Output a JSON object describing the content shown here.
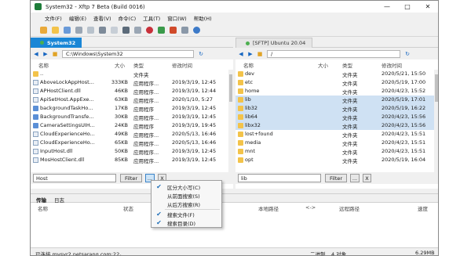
{
  "title": "System32 - Xftp 7 Beta (Build 0016)",
  "menu": [
    "文件(F)",
    "编辑(E)",
    "查看(V)",
    "命令(C)",
    "工具(T)",
    "窗口(W)",
    "帮助(H)"
  ],
  "left_pane": {
    "tab": "System32",
    "path": "C:\\Windows\\System32",
    "columns": [
      "名称",
      "大小",
      "类型",
      "修改时间"
    ],
    "rows": [
      {
        "name": "..",
        "size": "",
        "type": "文件夹",
        "modified": "",
        "icon": "folder"
      },
      {
        "name": "AboveLockAppHost...",
        "size": "333KB",
        "type": "应用程序...",
        "modified": "2019/3/19, 12:45",
        "icon": "file"
      },
      {
        "name": "APHostClient.dll",
        "size": "46KB",
        "type": "应用程序...",
        "modified": "2019/3/19, 12:44",
        "icon": "file"
      },
      {
        "name": "ApiSetHost.AppExe...",
        "size": "63KB",
        "type": "应用程序...",
        "modified": "2020/1/10, 5:27",
        "icon": "file"
      },
      {
        "name": "backgroundTaskHo...",
        "size": "17KB",
        "type": "应用程序",
        "modified": "2019/3/19, 12:45",
        "icon": "exe"
      },
      {
        "name": "BackgroundTransfe...",
        "size": "30KB",
        "type": "应用程序...",
        "modified": "2019/3/19, 12:45",
        "icon": "exe"
      },
      {
        "name": "CameraSettingsUIH...",
        "size": "24KB",
        "type": "应用程序",
        "modified": "2019/3/19, 19:45",
        "icon": "exe"
      },
      {
        "name": "CloudExperienceHo...",
        "size": "49KB",
        "type": "应用程序...",
        "modified": "2020/5/13, 16:46",
        "icon": "file"
      },
      {
        "name": "CloudExperienceHo...",
        "size": "65KB",
        "type": "应用程序...",
        "modified": "2020/5/13, 16:46",
        "icon": "file"
      },
      {
        "name": "InputHost.dll",
        "size": "50KB",
        "type": "应用程序...",
        "modified": "2019/3/19, 12:45",
        "icon": "file"
      },
      {
        "name": "MosHostClient.dll",
        "size": "85KB",
        "type": "应用程序...",
        "modified": "2019/3/19, 12:45",
        "icon": "file"
      }
    ],
    "filter_value": "Host",
    "filter_label": "Filter",
    "options_label": "...",
    "clear_label": "X"
  },
  "right_pane": {
    "tab": "[SFTP] Ubuntu 20.04",
    "path": "/",
    "columns": [
      "名称",
      "大小",
      "类型",
      "修改时间"
    ],
    "rows": [
      {
        "name": "dev",
        "type": "文件夹",
        "modified": "2020/5/21, 15:50",
        "selected": false
      },
      {
        "name": "etc",
        "type": "文件夹",
        "modified": "2020/5/19, 17:00",
        "selected": false
      },
      {
        "name": "home",
        "type": "文件夹",
        "modified": "2020/4/23, 15:52",
        "selected": false
      },
      {
        "name": "lib",
        "type": "文件夹",
        "modified": "2020/5/19, 17:01",
        "selected": true
      },
      {
        "name": "lib32",
        "type": "文件夹",
        "modified": "2020/5/19, 16:22",
        "selected": true
      },
      {
        "name": "lib64",
        "type": "文件夹",
        "modified": "2020/4/23, 15:56",
        "selected": true
      },
      {
        "name": "libx32",
        "type": "文件夹",
        "modified": "2020/4/23, 15:56",
        "selected": true
      },
      {
        "name": "lost+found",
        "type": "文件夹",
        "modified": "2020/4/23, 15:51",
        "selected": false
      },
      {
        "name": "media",
        "type": "文件夹",
        "modified": "2020/4/23, 15:51",
        "selected": false
      },
      {
        "name": "mnt",
        "type": "文件夹",
        "modified": "2020/4/23, 15:51",
        "selected": false
      },
      {
        "name": "opt",
        "type": "文件夹",
        "modified": "2020/5/19, 16:04",
        "selected": false
      }
    ],
    "filter_value": "lib",
    "filter_label": "Filter",
    "options_label": "...",
    "clear_label": "X"
  },
  "dropdown": {
    "items": [
      {
        "label": "区分大小写(C)",
        "checked": true
      },
      {
        "label": "从前面搜索(S)",
        "checked": false
      },
      {
        "label": "从后方搜索(R)",
        "checked": false
      },
      {
        "label": "搜索文件(F)",
        "checked": true
      },
      {
        "label": "搜索目录(D)",
        "checked": true
      }
    ]
  },
  "transfer": {
    "tabs": [
      "传输",
      "日志"
    ],
    "columns": [
      "名称",
      "状态",
      "本地路径",
      "<->",
      "远程路径",
      "速度"
    ]
  },
  "status": {
    "connected": "已连接 mysvr2.netsarang.com:22。",
    "mode": "二进制",
    "selected_count": "4 对象",
    "size": "6.29MB"
  }
}
